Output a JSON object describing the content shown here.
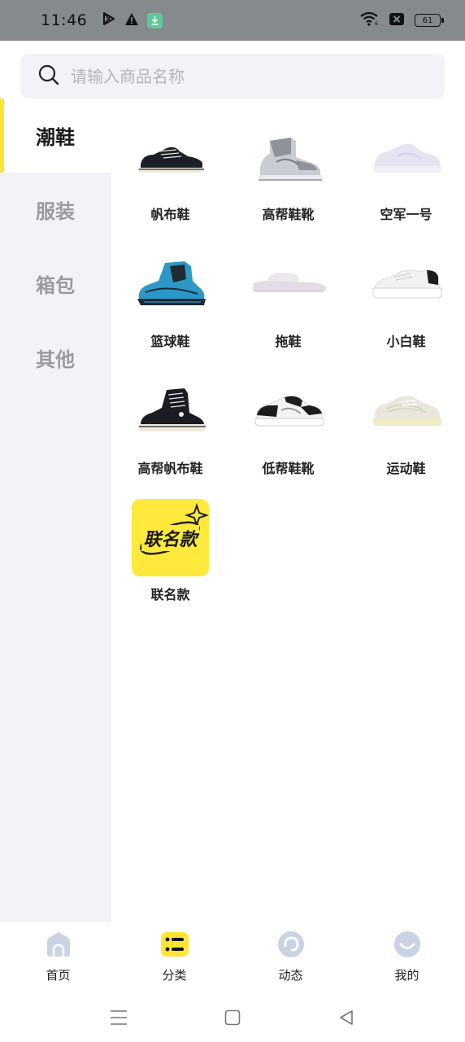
{
  "status_bar": {
    "time": "11:46",
    "battery_level": "61",
    "icons": [
      "play-store-icon",
      "warning-icon",
      "download-icon",
      "wifi-icon",
      "sim-x-icon",
      "battery-icon"
    ]
  },
  "search": {
    "placeholder": "请输入商品名称"
  },
  "sidebar": {
    "items": [
      {
        "label": "潮鞋",
        "active": true
      },
      {
        "label": "服装",
        "active": false
      },
      {
        "label": "箱包",
        "active": false
      },
      {
        "label": "其他",
        "active": false
      }
    ]
  },
  "categories": [
    {
      "label": "帆布鞋"
    },
    {
      "label": "高帮鞋靴"
    },
    {
      "label": "空军一号"
    },
    {
      "label": "篮球鞋"
    },
    {
      "label": "拖鞋"
    },
    {
      "label": "小白鞋"
    },
    {
      "label": "高帮帆布鞋"
    },
    {
      "label": "低帮鞋靴"
    },
    {
      "label": "运动鞋"
    },
    {
      "label": "联名款",
      "tile_text": "联名款"
    }
  ],
  "bottom_nav": {
    "items": [
      {
        "label": "首页",
        "icon": "home-icon"
      },
      {
        "label": "分类",
        "icon": "category-icon",
        "active": true
      },
      {
        "label": "动态",
        "icon": "feed-icon"
      },
      {
        "label": "我的",
        "icon": "profile-icon"
      }
    ]
  },
  "colors": {
    "accent_yellow": "#ffe433",
    "sidebar_bg": "#f3f3f7",
    "status_bar_bg": "#858a8c",
    "inactive_icon": "#c9d3e3"
  }
}
